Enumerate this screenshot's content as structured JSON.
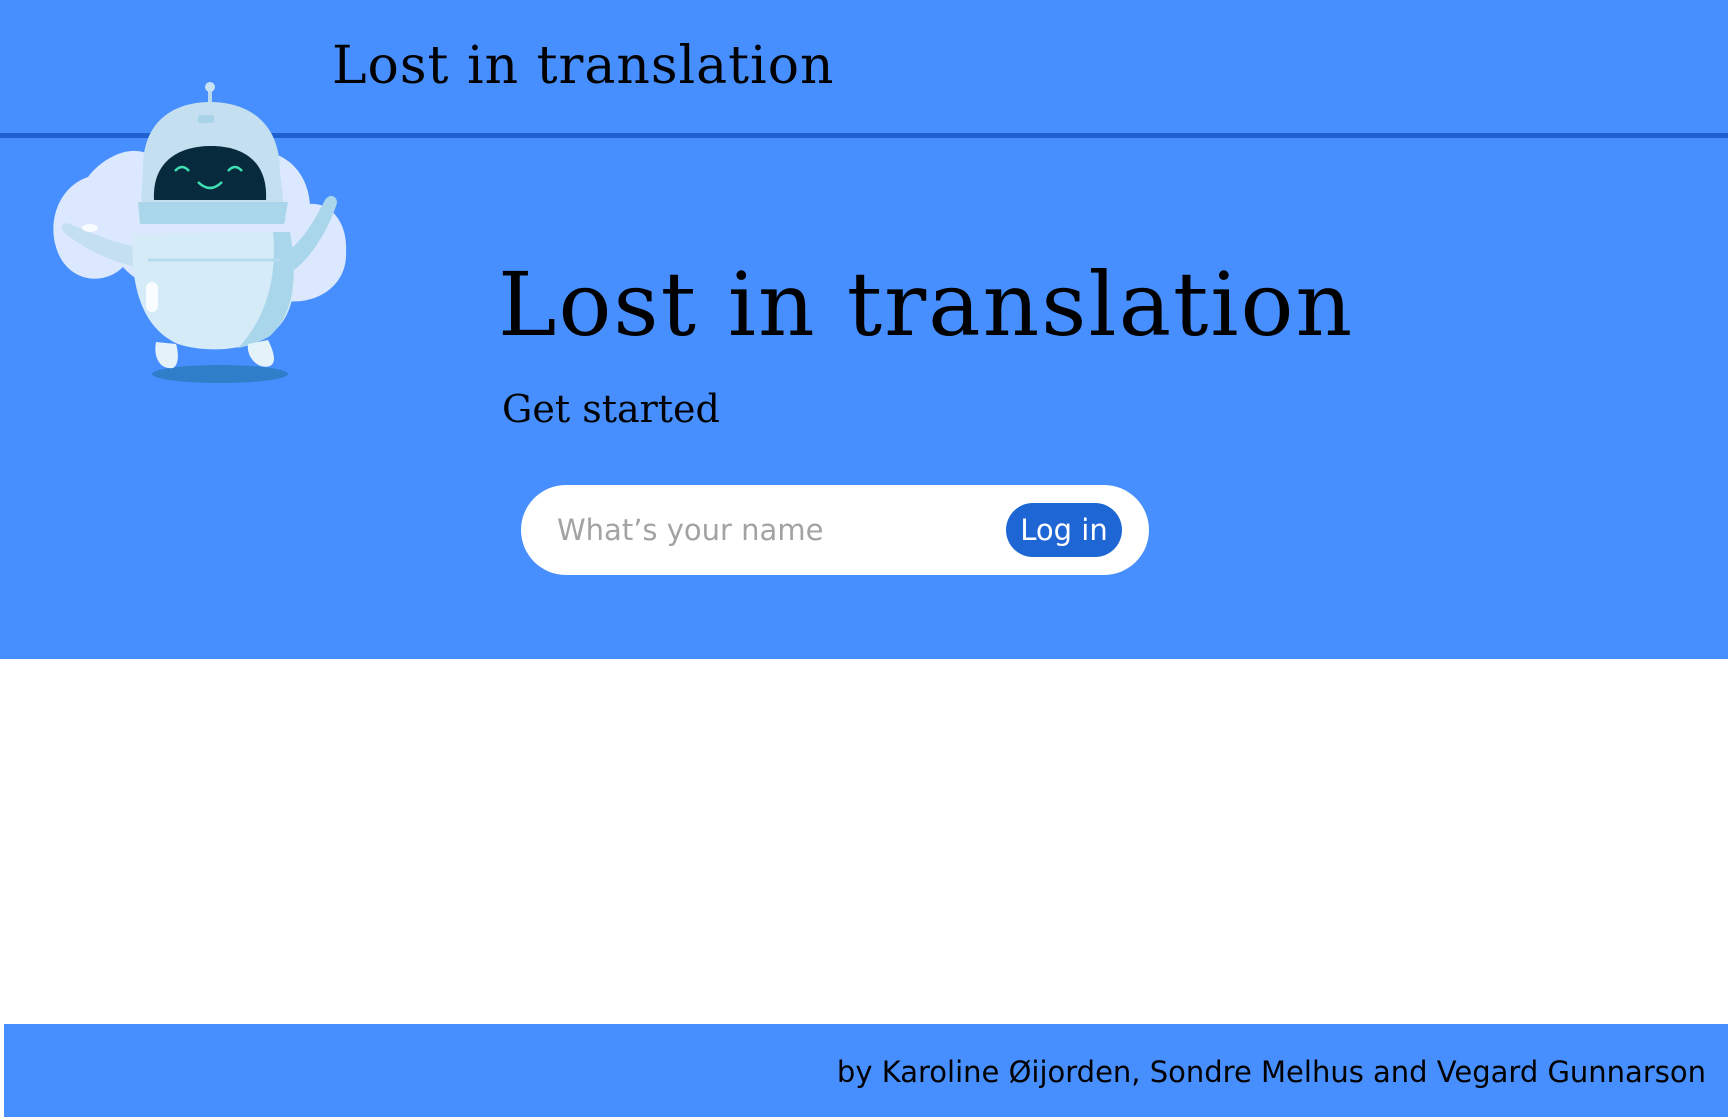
{
  "header": {
    "title": "Lost in translation"
  },
  "hero": {
    "title": "Lost in translation",
    "subtitle": "Get started",
    "mascot_icon": "robot-icon"
  },
  "login": {
    "name_value": "",
    "name_placeholder": "What’s your name",
    "button_label": "Log in"
  },
  "footer": {
    "credits": "by Karoline Øijorden, Sondre Melhus and Vegard Gunnarson"
  },
  "colors": {
    "brand_blue": "#478ffe",
    "divider_blue": "#1f5fd0",
    "button_blue": "#1f66d5"
  }
}
